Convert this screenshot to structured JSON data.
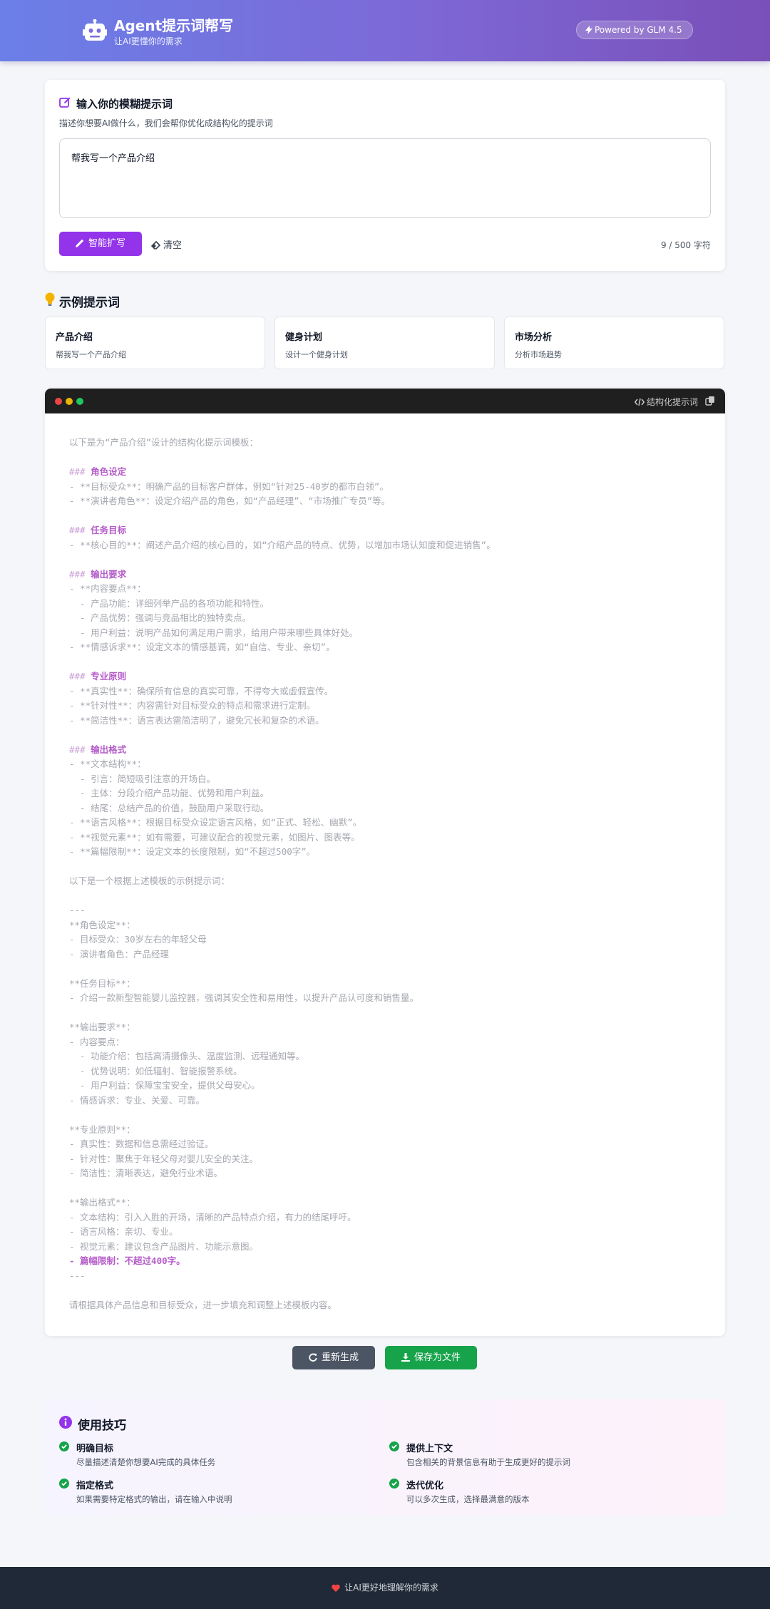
{
  "header": {
    "title": "Agent提示词帮写",
    "subtitle": "让AI更懂你的需求",
    "powered": "Powered by GLM 4.5"
  },
  "input_section": {
    "title": "输入你的模糊提示词",
    "description": "描述你想要AI做什么，我们会帮你优化成结构化的提示词",
    "value": "帮我写一个产品介绍",
    "expand_label": "智能扩写",
    "clear_label": "清空",
    "char_count": "9 / 500 字符"
  },
  "examples": {
    "title": "示例提示词",
    "items": [
      {
        "title": "产品介绍",
        "desc": "帮我写一个产品介绍"
      },
      {
        "title": "健身计划",
        "desc": "设计一个健身计划"
      },
      {
        "title": "市场分析",
        "desc": "分析市场趋势"
      }
    ]
  },
  "result": {
    "label": "结构化提示词",
    "lines": [
      {
        "t": "以下是为“产品介绍”设计的结构化提示词模板：",
        "c": ""
      },
      {
        "t": "",
        "c": ""
      },
      {
        "t": "### 角色设定",
        "c": "h"
      },
      {
        "t": "- **目标受众**：明确产品的目标客户群体，例如“针对25-40岁的都市白领”。",
        "c": ""
      },
      {
        "t": "- **演讲者角色**：设定介绍产品的角色，如“产品经理”、“市场推广专员”等。",
        "c": ""
      },
      {
        "t": "",
        "c": ""
      },
      {
        "t": "### 任务目标",
        "c": "h"
      },
      {
        "t": "- **核心目的**：阐述产品介绍的核心目的，如“介绍产品的特点、优势，以增加市场认知度和促进销售”。",
        "c": ""
      },
      {
        "t": "",
        "c": ""
      },
      {
        "t": "### 输出要求",
        "c": "h"
      },
      {
        "t": "- **内容要点**：",
        "c": ""
      },
      {
        "t": "  - 产品功能：详细列举产品的各项功能和特性。",
        "c": ""
      },
      {
        "t": "  - 产品优势：强调与竞品相比的独特卖点。",
        "c": ""
      },
      {
        "t": "  - 用户利益：说明产品如何满足用户需求，给用户带来哪些具体好处。",
        "c": ""
      },
      {
        "t": "- **情感诉求**：设定文本的情感基调，如“自信、专业、亲切”。",
        "c": ""
      },
      {
        "t": "",
        "c": ""
      },
      {
        "t": "### 专业原则",
        "c": "h"
      },
      {
        "t": "- **真实性**：确保所有信息的真实可靠，不得夸大或虚假宣传。",
        "c": ""
      },
      {
        "t": "- **针对性**：内容需针对目标受众的特点和需求进行定制。",
        "c": ""
      },
      {
        "t": "- **简洁性**：语言表达需简洁明了，避免冗长和复杂的术语。",
        "c": ""
      },
      {
        "t": "",
        "c": ""
      },
      {
        "t": "### 输出格式",
        "c": "h"
      },
      {
        "t": "- **文本结构**：",
        "c": ""
      },
      {
        "t": "  - 引言：简短吸引注意的开场白。",
        "c": ""
      },
      {
        "t": "  - 主体：分段介绍产品功能、优势和用户利益。",
        "c": ""
      },
      {
        "t": "  - 结尾：总结产品的价值，鼓励用户采取行动。",
        "c": ""
      },
      {
        "t": "- **语言风格**：根据目标受众设定语言风格，如“正式、轻松、幽默”。",
        "c": ""
      },
      {
        "t": "- **视觉元素**：如有需要，可建议配合的视觉元素，如图片、图表等。",
        "c": ""
      },
      {
        "t": "- **篇幅限制**：设定文本的长度限制，如“不超过500字”。",
        "c": ""
      },
      {
        "t": "",
        "c": ""
      },
      {
        "t": "以下是一个根据上述模板的示例提示词：",
        "c": ""
      },
      {
        "t": "",
        "c": ""
      },
      {
        "t": "---",
        "c": ""
      },
      {
        "t": "**角色设定**：",
        "c": ""
      },
      {
        "t": "- 目标受众：30岁左右的年轻父母",
        "c": ""
      },
      {
        "t": "- 演讲者角色：产品经理",
        "c": ""
      },
      {
        "t": "",
        "c": ""
      },
      {
        "t": "**任务目标**：",
        "c": ""
      },
      {
        "t": "- 介绍一款新型智能婴儿监控器，强调其安全性和易用性，以提升产品认可度和销售量。",
        "c": ""
      },
      {
        "t": "",
        "c": ""
      },
      {
        "t": "**输出要求**：",
        "c": ""
      },
      {
        "t": "- 内容要点：",
        "c": ""
      },
      {
        "t": "  - 功能介绍：包括高清摄像头、温度监测、远程通知等。",
        "c": ""
      },
      {
        "t": "  - 优势说明：如低辐射、智能报警系统。",
        "c": ""
      },
      {
        "t": "  - 用户利益：保障宝宝安全，提供父母安心。",
        "c": ""
      },
      {
        "t": "- 情感诉求：专业、关爱、可靠。",
        "c": ""
      },
      {
        "t": "",
        "c": ""
      },
      {
        "t": "**专业原则**：",
        "c": ""
      },
      {
        "t": "- 真实性：数据和信息需经过验证。",
        "c": ""
      },
      {
        "t": "- 针对性：聚焦于年轻父母对婴儿安全的关注。",
        "c": ""
      },
      {
        "t": "- 简洁性：清晰表达，避免行业术语。",
        "c": ""
      },
      {
        "t": "",
        "c": ""
      },
      {
        "t": "**输出格式**：",
        "c": ""
      },
      {
        "t": "- 文本结构：引入入胜的开场，清晰的产品特点介绍，有力的结尾呼吁。",
        "c": ""
      },
      {
        "t": "- 语言风格：亲切、专业。",
        "c": ""
      },
      {
        "t": "- 视觉元素：建议包含产品图片、功能示意图。",
        "c": ""
      },
      {
        "t": "- 篇幅限制：不超过400字。",
        "c": "x"
      },
      {
        "t": "---",
        "c": ""
      },
      {
        "t": "",
        "c": ""
      },
      {
        "t": "请根据具体产品信息和目标受众，进一步填充和调整上述模板内容。",
        "c": ""
      }
    ]
  },
  "actions": {
    "regenerate": "重新生成",
    "save": "保存为文件"
  },
  "tips": {
    "title": "使用技巧",
    "items": [
      {
        "title": "明确目标",
        "desc": "尽量描述清楚你想要AI完成的具体任务"
      },
      {
        "title": "提供上下文",
        "desc": "包含相关的背景信息有助于生成更好的提示词"
      },
      {
        "title": "指定格式",
        "desc": "如果需要特定格式的输出，请在输入中说明"
      },
      {
        "title": "迭代优化",
        "desc": "可以多次生成，选择最满意的版本"
      }
    ]
  },
  "footer": {
    "text": "让AI更好地理解你的需求"
  },
  "colors": {
    "primary_purple": "#9333ea",
    "success_green": "#16a34a",
    "dark_bar": "#1f1f1f",
    "footer_bg": "#1f2937"
  }
}
